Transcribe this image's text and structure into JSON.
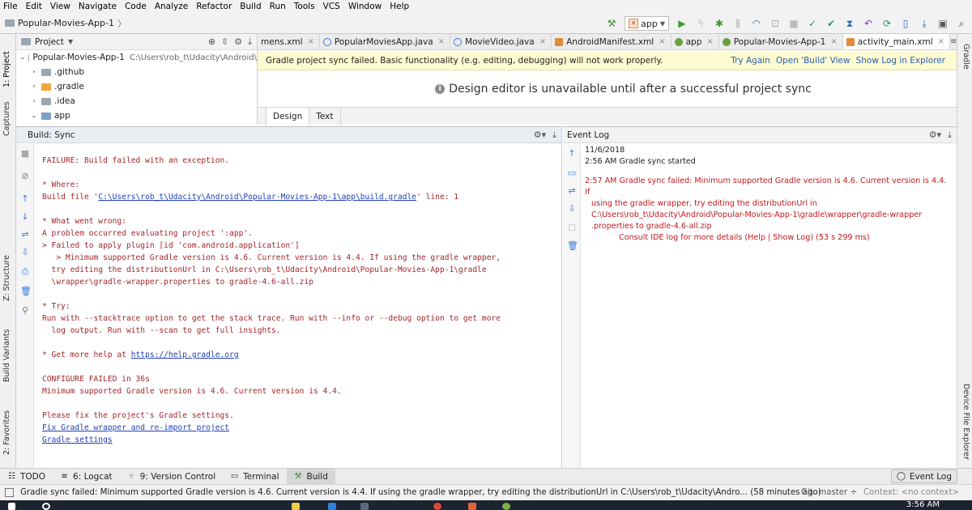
{
  "menu": {
    "items": [
      "File",
      "Edit",
      "View",
      "Navigate",
      "Code",
      "Analyze",
      "Refactor",
      "Build",
      "Run",
      "Tools",
      "VCS",
      "Window",
      "Help"
    ]
  },
  "nav": {
    "breadcrumb": "Popular-Movies-App-1",
    "run_config": "app"
  },
  "left_strip": {
    "project_tab": "1: Project",
    "captures_tab": "Captures",
    "structure_tab": "Z: Structure",
    "build_variants_tab": "Build Variants",
    "favorites_tab": "2: Favorites"
  },
  "right_strip": {
    "gradle_tab": "Gradle",
    "device_explorer_tab": "Device File Explorer"
  },
  "project_panel": {
    "header": "Project",
    "root_name": "Popular-Movies-App-1",
    "root_path": "C:\\Users\\rob_t\\Udacity\\Android\\",
    "items": [
      ".github",
      ".gradle",
      ".idea",
      "app"
    ]
  },
  "editor_tabs": [
    {
      "label": "mens.xml"
    },
    {
      "label": "PopularMoviesApp.java"
    },
    {
      "label": "MovieVideo.java"
    },
    {
      "label": "AndroidManifest.xml"
    },
    {
      "label": "app"
    },
    {
      "label": "Popular-Movies-App-1"
    },
    {
      "label": "activity_main.xml"
    }
  ],
  "banner": {
    "message": "Gradle project sync failed. Basic functionality (e.g. editing, debugging) will not work properly.",
    "try_again": "Try Again",
    "open_build_view": "Open 'Build' View",
    "show_log": "Show Log in Explorer"
  },
  "editor": {
    "message": "Design editor is unavailable until after a successful project sync"
  },
  "design_tabs": {
    "design": "Design",
    "text": "Text"
  },
  "build_panel": {
    "header": "Build: Sync",
    "lines": {
      "l1": "FAILURE: Build failed with an exception.",
      "l2": "* Where:",
      "l3_pre": "Build file '",
      "l3_path": "C:\\Users\\rob_t\\Udacity\\Android\\Popular-Movies-App-1\\app\\build.gradle",
      "l3_post": "' line: 1",
      "l4": "* What went wrong:",
      "l5": "A problem occurred evaluating project ':app'.",
      "l6": "> Failed to apply plugin [id 'com.android.application']",
      "l7": "   > Minimum supported Gradle version is 4.6. Current version is 4.4. If using the gradle wrapper,",
      "l8": "  try editing the distributionUrl in C:\\Users\\rob_t\\Udacity\\Android\\Popular-Movies-App-1\\gradle",
      "l9": "  \\wrapper\\gradle-wrapper.properties to gradle-4.6-all.zip",
      "l10": "* Try:",
      "l11": "Run with --stacktrace option to get the stack trace. Run with --info or --debug option to get more",
      "l12": "  log output. Run with --scan to get full insights.",
      "l13_pre": "* Get more help at ",
      "l13_link": "https://help.gradle.org",
      "l14": "CONFIGURE FAILED in 36s",
      "l15": "Minimum supported Gradle version is 4.6. Current version is 4.4.",
      "l16": "Please fix the project's Gradle settings.",
      "l17_link": "Fix Gradle wrapper and re-import project",
      "l18_link": "Gradle settings"
    }
  },
  "event_log": {
    "header": "Event Log",
    "date": "11/6/2018",
    "entry1": "2:56 AM  Gradle sync started",
    "entry2_line1": "2:57 AM  Gradle sync failed: Minimum supported Gradle version is 4.6. Current version is 4.4. If",
    "entry2_line2": "using the gradle wrapper, try editing the distributionUrl in",
    "entry2_line3": "C:\\Users\\rob_t\\Udacity\\Android\\Popular-Movies-App-1\\gradle\\wrapper\\gradle-wrapper",
    "entry2_line4": ".properties to gradle-4.6-all.zip",
    "entry2_line5": "Consult IDE log for more details (Help | Show Log) (53 s 299 ms)"
  },
  "bottom_tabs": {
    "todo": "TODO",
    "logcat": "6: Logcat",
    "version_control": "9: Version Control",
    "terminal": "Terminal",
    "build": "Build",
    "event_log": "Event Log"
  },
  "status": {
    "message": "Gradle sync failed: Minimum supported Gradle version is 4.6. Current version is 4.4. If using the gradle wrapper, try editing the distributionUrl in C:\\Users\\rob_t\\Udacity\\Andro... (58 minutes ago)",
    "git": "Git: master ÷",
    "context": "Context: <no context>"
  },
  "taskbar": {
    "clock": "3:56 AM"
  }
}
